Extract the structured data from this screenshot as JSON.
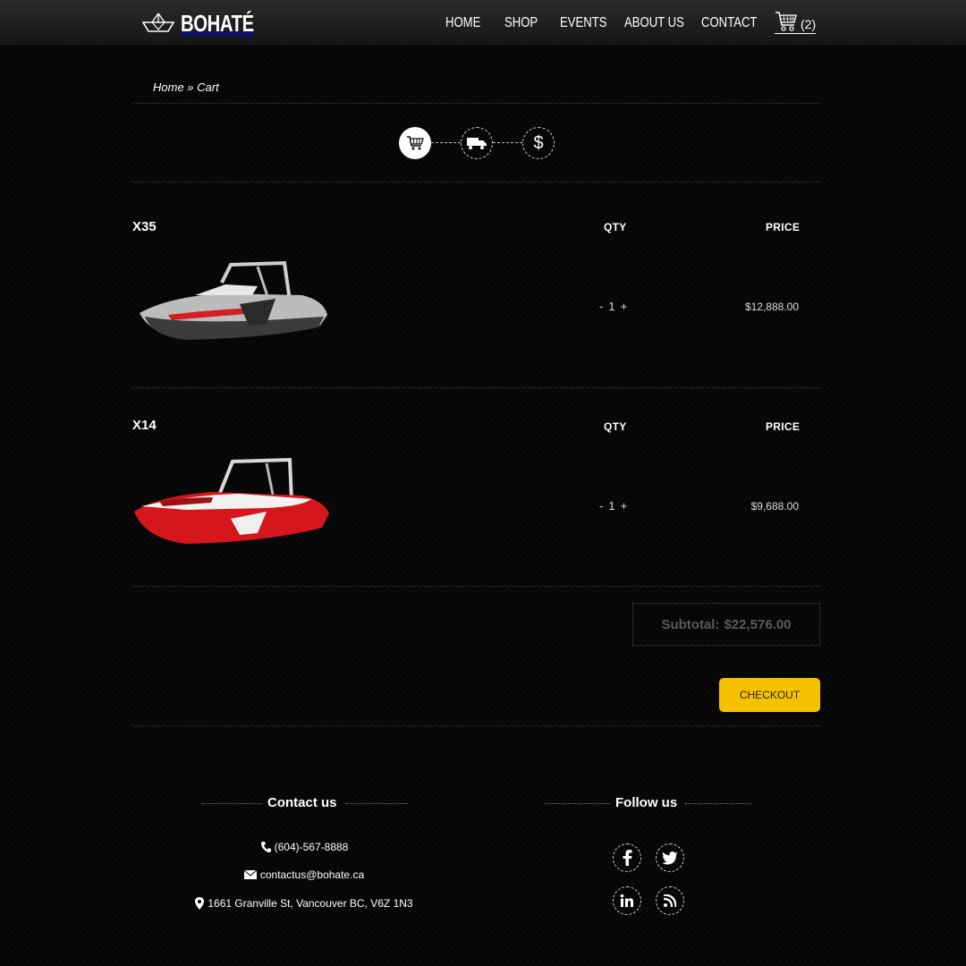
{
  "header": {
    "logo_text": "BOHATÉ",
    "nav": [
      "HOME",
      "SHOP",
      "EVENTS",
      "ABOUT US",
      "CONTACT"
    ],
    "cart_count": "(2)"
  },
  "breadcrumb": {
    "home": "Home",
    "separator": " » ",
    "current": "Cart"
  },
  "steps": [
    {
      "icon": "cart-icon",
      "active": true
    },
    {
      "icon": "truck-icon",
      "active": false
    },
    {
      "icon": "dollar-icon",
      "label": "$",
      "active": false
    }
  ],
  "cart": {
    "qty_header": "QTY",
    "price_header": "PRICE",
    "items": [
      {
        "name": "X35",
        "qty_minus": "-",
        "qty": "1",
        "qty_plus": "+",
        "price": "$12,888.00",
        "image": "silver-boat"
      },
      {
        "name": "X14",
        "qty_minus": "-",
        "qty": "1",
        "qty_plus": "+",
        "price": "$9,688.00",
        "image": "red-boat"
      }
    ],
    "subtotal_label": "Subtotal:",
    "subtotal_value": "$22,576.00",
    "checkout_label": "CHECKOUT"
  },
  "footer": {
    "contact_title": "Contact us",
    "phone": "(604)-567-8888",
    "email": "contactus@bohate.ca",
    "address": "1661 Granville St, Vancouver BC, V6Z 1N3",
    "follow_title": "Follow us",
    "social": [
      "facebook-icon",
      "twitter-icon",
      "linkedin-icon",
      "rss-icon"
    ]
  },
  "colors": {
    "accent": "#f6c200",
    "background": "#050505",
    "red_boat": "#d5161d"
  }
}
